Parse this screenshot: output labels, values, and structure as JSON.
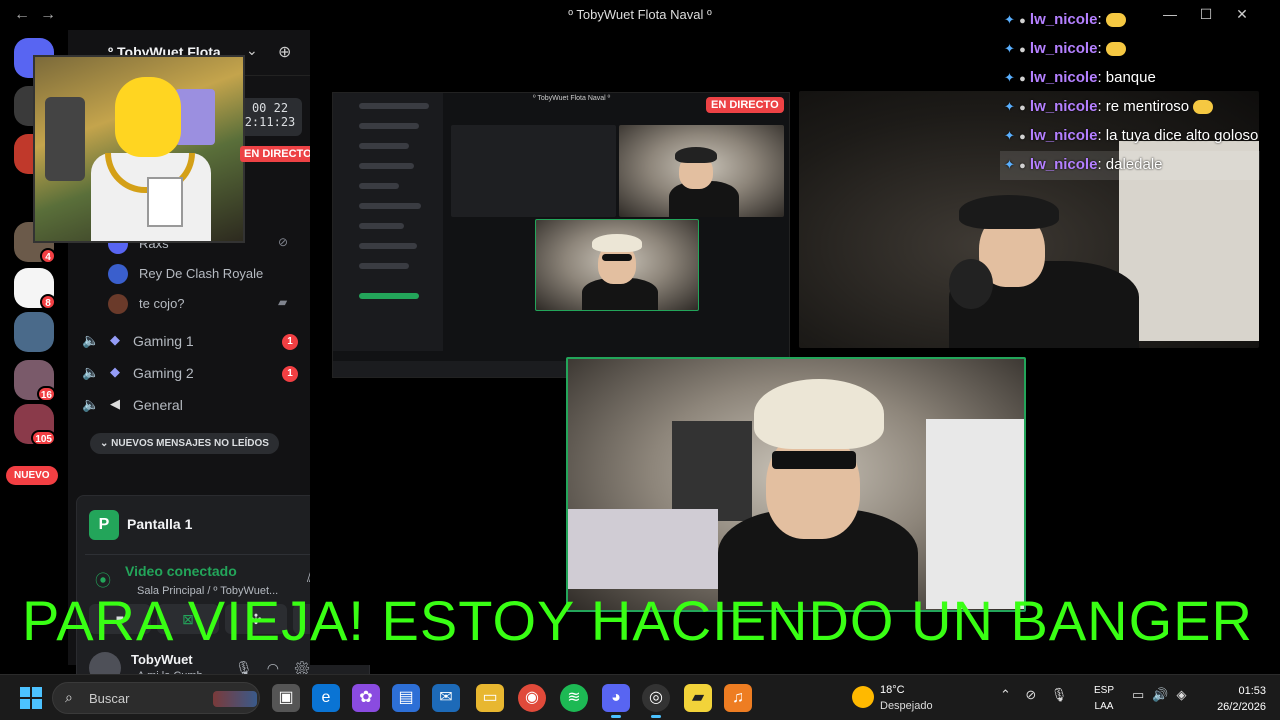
{
  "window": {
    "title": "º TobyWuet Flota Naval º",
    "nav_back": "←",
    "nav_forward": "→",
    "controls": [
      "—",
      "☐",
      "✕"
    ]
  },
  "rail": {
    "badges": [
      "4",
      "8",
      "16",
      "105"
    ],
    "nuevo": "NUEVO"
  },
  "server": {
    "name": "º TobyWuet Flota",
    "timer_top": "00 22",
    "timer_bottom": "2:11:23"
  },
  "members": [
    {
      "name": "Raxs"
    },
    {
      "name": "Rey De Clash Royale"
    },
    {
      "name": "te cojo?"
    }
  ],
  "channels": [
    {
      "label": "Gaming 1",
      "count": "1"
    },
    {
      "label": "Gaming 2",
      "count": "1"
    },
    {
      "label": "General",
      "count": ""
    }
  ],
  "new_messages": "NUEVOS MENSAJES NO LEÍDOS",
  "voice_panel": {
    "stream_title": "Pantalla 1",
    "status": "Video conectado",
    "location": "Sala Principal / º TobyWuet...",
    "user_name": "TobyWuet",
    "user_status": "• A mi la Cumb"
  },
  "live_label": "EN DIRECTO",
  "mini_title": "º TobyWuet Flota Naval º",
  "chat": [
    {
      "user": "lw_nicole",
      "text": "",
      "emoji": true
    },
    {
      "user": "lw_nicole",
      "text": "",
      "emoji": true
    },
    {
      "user": "lw_nicole",
      "text": "banque",
      "emoji": false
    },
    {
      "user": "lw_nicole",
      "text": "re mentiroso",
      "emoji": true
    },
    {
      "user": "lw_nicole",
      "text": "la tuya dice alto goloso",
      "emoji": false
    },
    {
      "user": "lw_nicole",
      "text": "daledale",
      "emoji": false
    }
  ],
  "caption": "PARA VIEJA! ESTOY HACIENDO UN BANGER",
  "taskbar": {
    "search_placeholder": "Buscar",
    "weather_temp": "18°C",
    "weather_desc": "Despejado",
    "lang_top": "ESP",
    "lang_bottom": "LAA",
    "time": "01:53",
    "date": "26/2/2026"
  }
}
